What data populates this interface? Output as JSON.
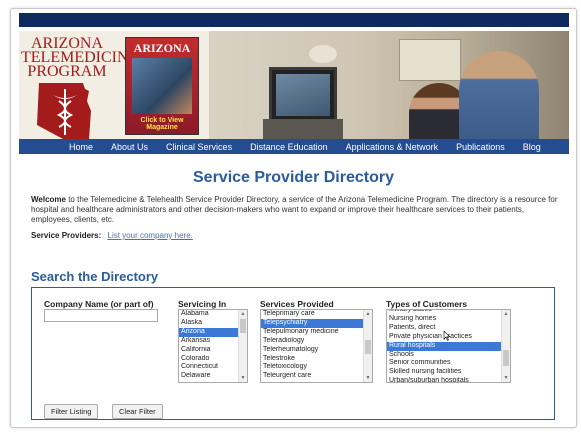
{
  "banner": {
    "logo_text": "ARIZONA\nTELEMEDICINE\nPROGRAM",
    "magazine_title": "ARIZONA",
    "magazine_link": "Click to View Magazine"
  },
  "nav": [
    "Home",
    "About Us",
    "Clinical Services",
    "Distance Education",
    "Applications & Network",
    "Publications",
    "Blog"
  ],
  "page_title": "Service Provider Directory",
  "welcome": {
    "bold": "Welcome",
    "text": " to the Telemedicine & Telehealth Service Provider Directory, a service of the Arizona Telemedicine Program. The directory is a resource for hospital and healthcare administrators and other decision-makers who want to expand or improve their healthcare services to their patients, employees, clients, etc."
  },
  "providers": {
    "label": "Service Providers:",
    "link": "List your company here."
  },
  "search": {
    "title": "Search the Directory",
    "company_label": "Company Name (or part of)",
    "company_value": "",
    "servicing_label": "Servicing In",
    "servicing_options": [
      "Alabama",
      "Alaska",
      "Arizona",
      "Arkansas",
      "California",
      "Colorado",
      "Connecticut",
      "Delaware"
    ],
    "servicing_selected": 2,
    "services_label": "Services Provided",
    "services_options": [
      "Teleprimary care",
      "Telepsychiatry",
      "Telepulmonary medicine",
      "Teleradiology",
      "Telerheumatology",
      "Telestroke",
      "Teletoxicology",
      "Teleurgent care"
    ],
    "services_selected": 1,
    "customers_label": "Types of Customers",
    "customers_options": [
      "Military bases",
      "Nursing homes",
      "Patients, direct",
      "Private physician practices",
      "Rural hospitals",
      "Schools",
      "Senior communities",
      "Skilled nursing facilities",
      "Urban/suburban hospitals"
    ],
    "customers_selected": 4,
    "filter_button": "Filter Listing",
    "clear_button": "Clear Filter"
  },
  "colors": {
    "header_dark": "#0f2a5f",
    "nav": "#244c90",
    "title": "#2a5c9c",
    "selection": "#3c79d6",
    "logo_red": "#a41b1b"
  }
}
